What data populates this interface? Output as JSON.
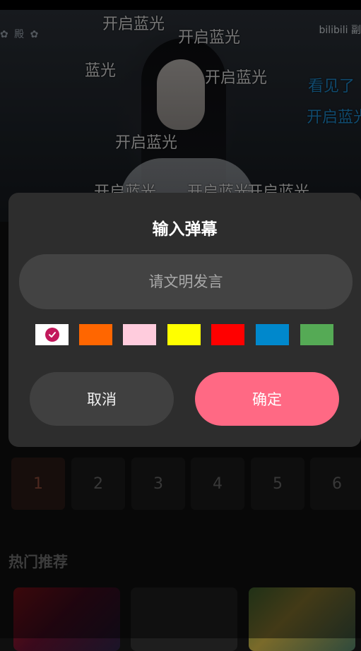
{
  "video": {
    "logo_left": "✿ 殿 ✿",
    "logo_right": "bilibili 副"
  },
  "danmaku": [
    {
      "text": "开启蓝光",
      "color": "#d8d8d8"
    },
    {
      "text": "开启蓝光",
      "color": "#d8d8d8"
    },
    {
      "text": "蓝光",
      "color": "#d8d8d8"
    },
    {
      "text": "开启蓝光",
      "color": "#d8d8d8"
    },
    {
      "text": "看见了",
      "color": "#1e88c8"
    },
    {
      "text": "开启蓝光",
      "color": "#1e88c8"
    },
    {
      "text": "开启蓝光",
      "color": "#d8d8d8"
    },
    {
      "text": "开启蓝光",
      "color": "#d8d8d8"
    },
    {
      "text": "开启蓝光",
      "color": "#d8d8d8"
    },
    {
      "text": "开启蓝光",
      "color": "#d8d8d8"
    }
  ],
  "dialog": {
    "title": "输入弹幕",
    "input_placeholder": "请文明发言",
    "input_value": "",
    "colors": [
      "#ffffff",
      "#ff6600",
      "#ffccdd",
      "#ffff00",
      "#ff0000",
      "#0088cc",
      "#55aa55"
    ],
    "selected_color_index": 0,
    "cancel_label": "取消",
    "confirm_label": "确定",
    "accent_color": "#ff6984"
  },
  "episodes": {
    "items": [
      "1",
      "2",
      "3",
      "4",
      "5",
      "6"
    ],
    "active_index": 0
  },
  "recommend": {
    "title": "热门推荐"
  }
}
